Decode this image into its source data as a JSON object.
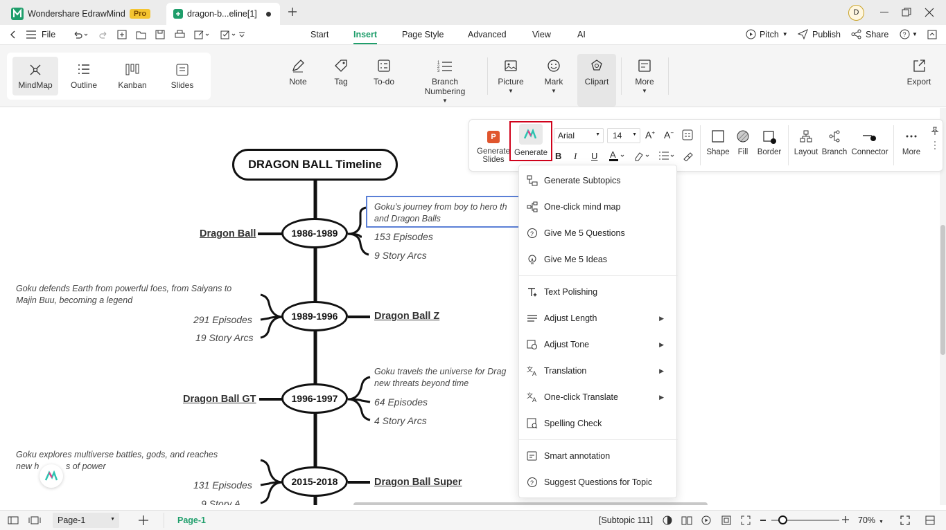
{
  "app": {
    "title": "Wondershare EdrawMind",
    "badge": "Pro",
    "doc_tab": "dragon-b...eline[1]",
    "avatar": "D"
  },
  "menu": {
    "file": "File",
    "tabs": [
      "Start",
      "Insert",
      "Page Style",
      "Advanced",
      "View",
      "AI"
    ],
    "active_tab": "Insert",
    "pitch": "Pitch",
    "publish": "Publish",
    "share": "Share"
  },
  "views": [
    "MindMap",
    "Outline",
    "Kanban",
    "Slides"
  ],
  "ribbon": {
    "note": "Note",
    "tag": "Tag",
    "todo": "To-do",
    "branch_numbering": "Branch Numbering",
    "picture": "Picture",
    "mark": "Mark",
    "clipart": "Clipart",
    "more": "More",
    "export": "Export"
  },
  "mindmap": {
    "title": "DRAGON BALL Timeline",
    "eras": [
      {
        "years": "1986-1989",
        "name": "Dragon Ball",
        "desc1": "Goku’s journey from boy to hero th",
        "desc2": "and Dragon Balls",
        "episodes": "153 Episodes",
        "arcs": "9 Story Arcs"
      },
      {
        "years": "1989-1996",
        "name": "Dragon Ball Z",
        "desc1": "Goku defends Earth from powerful foes, from Saiyans to",
        "desc2": "Majin Buu, becoming a legend",
        "episodes": "291 Episodes",
        "arcs": "19 Story Arcs"
      },
      {
        "years": "1996-1997",
        "name": "Dragon Ball GT",
        "desc1": "Goku travels the universe for Drag",
        "desc2": "new threats beyond time",
        "episodes": "64 Episodes",
        "arcs": "4 Story Arcs"
      },
      {
        "years": "2015-2018",
        "name": "Dragon Ball Super",
        "desc1": "Goku explores multiverse battles, gods, and reaches",
        "desc2a": "new h",
        "desc2b": "s of power",
        "episodes": "131 Episodes",
        "arcs": "9 Story A"
      }
    ]
  },
  "float_toolbar": {
    "generate_slides_1": "Generate",
    "generate_slides_2": "Slides",
    "generate": "Generate",
    "font": "Arial",
    "size": "14",
    "shape": "Shape",
    "fill": "Fill",
    "border": "Border",
    "layout": "Layout",
    "branch": "Branch",
    "connector": "Connector",
    "more": "More",
    "slides_icon_letter": "P"
  },
  "ai_menu": {
    "items": [
      "Generate Subtopics",
      "One-click mind map",
      "Give Me 5 Questions",
      "Give Me 5 Ideas",
      "Text Polishing",
      "Adjust Length",
      "Adjust Tone",
      "Translation",
      "One-click Translate",
      "Spelling Check",
      "Smart annotation",
      "Suggest Questions for Topic"
    ]
  },
  "status": {
    "page_select": "Page-1",
    "page_tab": "Page-1",
    "selection": "[Subtopic 111]",
    "zoom": "70%"
  },
  "colors": {
    "accent": "#1f9e6b",
    "highlight_border": "#d0021b",
    "selection_box": "#5a7fd6"
  }
}
